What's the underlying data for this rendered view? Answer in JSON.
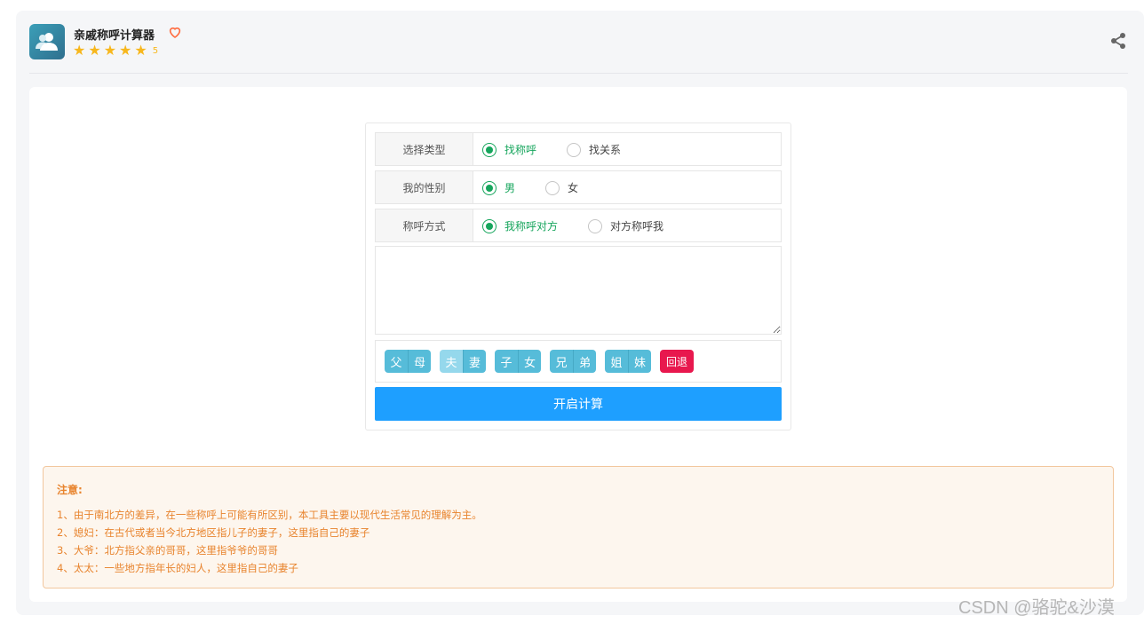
{
  "header": {
    "title": "亲戚称呼计算器",
    "rating": "5",
    "stars": 5,
    "icon": "users-icon",
    "accent": "#f7b71d"
  },
  "form": {
    "rows": [
      {
        "label": "选择类型",
        "options": [
          "找称呼",
          "找关系"
        ],
        "selected": 0
      },
      {
        "label": "我的性别",
        "options": [
          "男",
          "女"
        ],
        "selected": 0
      },
      {
        "label": "称呼方式",
        "options": [
          "我称呼对方",
          "对方称呼我"
        ],
        "selected": 0
      }
    ],
    "textarea_value": "",
    "relation_buttons": [
      [
        "父",
        "母"
      ],
      [
        "夫",
        "妻"
      ],
      [
        "子",
        "女"
      ],
      [
        "兄",
        "弟"
      ],
      [
        "姐",
        "妹"
      ]
    ],
    "back_label": "回退",
    "calc_label": "开启计算"
  },
  "notice": {
    "title": "注意:",
    "items": [
      "1、由于南北方的差异，在一些称呼上可能有所区别，本工具主要以现代生活常见的理解为主。",
      "2、媳妇：在古代或者当今北方地区指儿子的妻子，这里指自己的妻子",
      "3、大爷：北方指父亲的哥哥，这里指爷爷的哥哥",
      "4、太太：一些地方指年长的妇人，这里指自己的妻子"
    ]
  },
  "watermark": "CSDN @骆驼&沙漠",
  "colors": {
    "primary": "#1e9fff",
    "checked": "#16a55c",
    "danger": "#e8184e",
    "chip": "#56bcd9",
    "notice": "#e8842e"
  }
}
